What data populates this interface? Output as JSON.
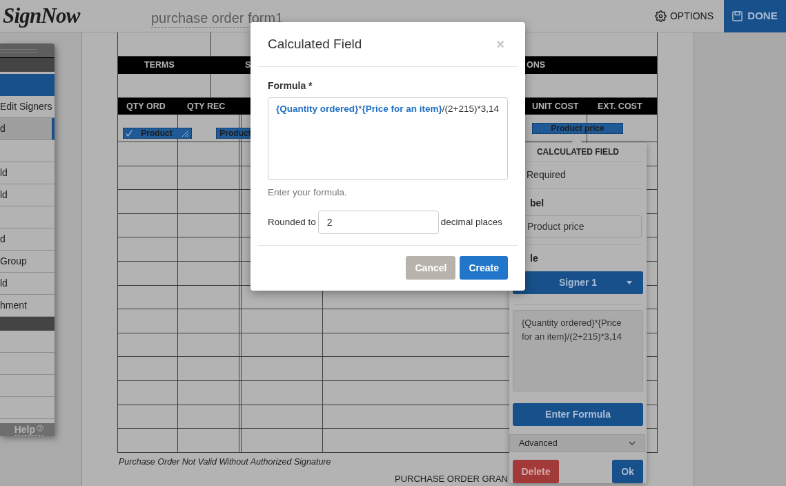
{
  "header": {
    "logo": "SignNow",
    "document_title": "purchase order form1",
    "options_button": "OPTIONS",
    "done_button": "DONE"
  },
  "left_panel": {
    "items": [
      {
        "kind": "text",
        "label": "Edit Signers",
        "selected": false
      },
      {
        "kind": "text",
        "label": "d",
        "selected": true
      },
      {
        "kind": "blank",
        "selected": false
      },
      {
        "kind": "text",
        "label": "ld",
        "selected": false
      },
      {
        "kind": "text",
        "label": "ld",
        "selected": false
      },
      {
        "kind": "blank",
        "selected": false
      },
      {
        "kind": "text",
        "label": "d",
        "selected": false
      },
      {
        "kind": "text",
        "label": "Group",
        "selected": false
      },
      {
        "kind": "text",
        "label": "ld",
        "selected": false
      },
      {
        "kind": "text",
        "label": "hment",
        "selected": false
      },
      {
        "kind": "band"
      },
      {
        "kind": "blank",
        "selected": false
      },
      {
        "kind": "blank",
        "selected": false
      },
      {
        "kind": "blank",
        "selected": false
      },
      {
        "kind": "blank",
        "selected": false
      }
    ],
    "help": "Help"
  },
  "document": {
    "terms_band": [
      "TERMS",
      "S",
      "ONS"
    ],
    "columns": [
      "QTY ORD",
      "QTY REC",
      "UNIT COST",
      "EXT. COST"
    ],
    "fields": [
      {
        "label": "Product",
        "checked": true
      },
      {
        "label": "Product",
        "checked": false
      },
      {
        "label": "Product price",
        "checked": false
      }
    ],
    "footer_note": "Purchase Order Not Valid Without Authorized Signature",
    "section_title": "PURCHASE ORDER GRAN"
  },
  "modal": {
    "title": "Calculated Field",
    "close": "×",
    "formula_label": "Formula *",
    "formula": [
      {
        "kind": "field",
        "text": "{Quantity ordered}"
      },
      {
        "kind": "operator",
        "text": "*"
      },
      {
        "kind": "field",
        "text": "{Price for an item}"
      },
      {
        "kind": "operator",
        "text": "/(2+215)*3,14"
      }
    ],
    "hint": "Enter your formula.",
    "rounded_label": "Rounded to",
    "rounded_value": "2",
    "decimal_label": "decimal places",
    "buttons": [
      {
        "label": "Cancel",
        "disabled": true
      },
      {
        "label": "Create",
        "disabled": false
      }
    ]
  },
  "popover": {
    "title": "CALCULATED FIELD",
    "required_label": "Required",
    "label_heading": "bel",
    "label_value": "Product price",
    "role_heading": "le",
    "role_value": "Signer 1",
    "formula_preview": "{Quantity ordered}*{Price for an item}/(2+215)*3,14",
    "enter_formula": "Enter Formula",
    "advanced": {
      "label": "Advanced",
      "expanded": false
    },
    "delete": "Delete",
    "ok": "Ok"
  }
}
